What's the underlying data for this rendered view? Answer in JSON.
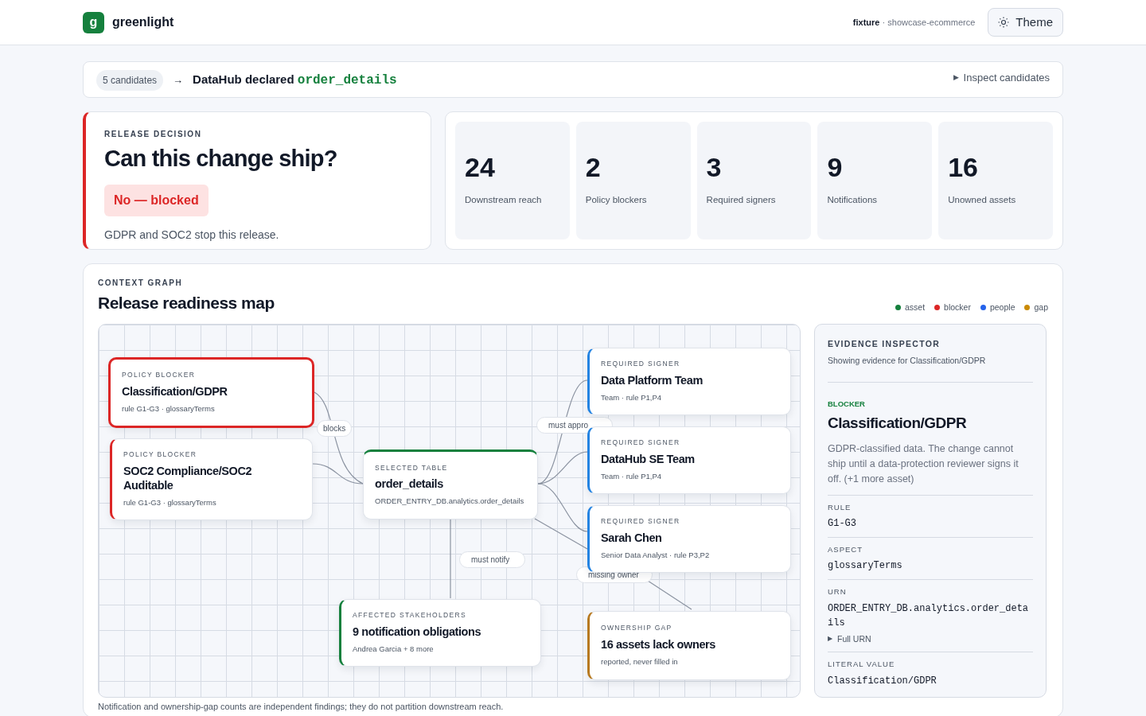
{
  "brand": {
    "logo": "g",
    "name": "greenlight"
  },
  "fixture": {
    "label": "fixture",
    "separator": "·",
    "value": "showcase-ecommerce"
  },
  "theme_button": "Theme",
  "candidates": {
    "count": "5 candidates",
    "arrow": "→",
    "text": "DataHub declared",
    "entity": "order_details",
    "toggle_icon": "▶",
    "toggle": "Inspect candidates"
  },
  "decision": {
    "eyebrow": "RELEASE DECISION",
    "title": "Can this change ship?",
    "verdict": "No — blocked",
    "blocked": true,
    "summary": "GDPR and SOC2 stop this release."
  },
  "metrics": [
    {
      "value": "24",
      "label": "Downstream reach"
    },
    {
      "value": "2",
      "label": "Policy blockers"
    },
    {
      "value": "3",
      "label": "Required signers"
    },
    {
      "value": "9",
      "label": "Notifications"
    },
    {
      "value": "16",
      "label": "Unowned assets"
    }
  ],
  "graph": {
    "eyebrow": "CONTEXT GRAPH",
    "title": "Release readiness map",
    "legend": [
      {
        "label": "asset",
        "color": "#15803d"
      },
      {
        "label": "blocker",
        "color": "#dc2626"
      },
      {
        "label": "people",
        "color": "#2563eb"
      },
      {
        "label": "gap",
        "color": "#ca8a04"
      }
    ],
    "nodes": [
      {
        "kind": "blocker",
        "eyebrow": "POLICY BLOCKER",
        "title": "Classification/GDPR",
        "meta": "rule G1-G3 · glossaryTerms",
        "selected": true
      },
      {
        "kind": "blocker",
        "eyebrow": "POLICY BLOCKER",
        "title": "SOC2 Compliance/SOC2 Auditable",
        "meta": "rule G1-G3 · glossaryTerms",
        "selected": false
      },
      {
        "kind": "table",
        "eyebrow": "SELECTED TABLE",
        "title": "order_details",
        "meta": "ORDER_ENTRY_DB.analytics.order_details",
        "selected": false
      },
      {
        "kind": "signer",
        "eyebrow": "REQUIRED SIGNER",
        "title": "Data Platform Team",
        "meta": "Team · rule P1,P4",
        "selected": false
      },
      {
        "kind": "signer",
        "eyebrow": "REQUIRED SIGNER",
        "title": "DataHub SE Team",
        "meta": "Team · rule P1,P4",
        "selected": false
      },
      {
        "kind": "signer",
        "eyebrow": "REQUIRED SIGNER",
        "title": "Sarah Chen",
        "meta": "Senior Data Analyst · rule P3,P2",
        "selected": false
      },
      {
        "kind": "stakeholders",
        "eyebrow": "AFFECTED STAKEHOLDERS",
        "title": "9 notification obligations",
        "meta": "Andrea Garcia + 8 more",
        "selected": false
      },
      {
        "kind": "gap",
        "eyebrow": "OWNERSHIP GAP",
        "title": "16 assets lack owners",
        "meta": "reported, never filled in",
        "selected": false
      }
    ],
    "edge_labels": [
      "blocks",
      "must appro",
      "must notify",
      "missing owner"
    ],
    "footnote": "Notification and ownership-gap counts are independent findings; they do not partition downstream reach."
  },
  "inspector": {
    "eyebrow": "EVIDENCE INSPECTOR",
    "subtitle": "Showing evidence for Classification/GDPR",
    "kind_label": "BLOCKER",
    "title": "Classification/GDPR",
    "description": "GDPR-classified data. The change cannot ship until a data-protection reviewer signs it off. (+1 more asset)",
    "fields": [
      {
        "label": "RULE",
        "value": "G1-G3"
      },
      {
        "label": "ASPECT",
        "value": "glossaryTerms"
      },
      {
        "label": "URN",
        "value": "ORDER_ENTRY_DB.analytics.order_details",
        "disclosure_icon": "▶",
        "disclosure": "Full URN"
      },
      {
        "label": "LITERAL VALUE",
        "value": "Classification/GDPR"
      }
    ]
  }
}
